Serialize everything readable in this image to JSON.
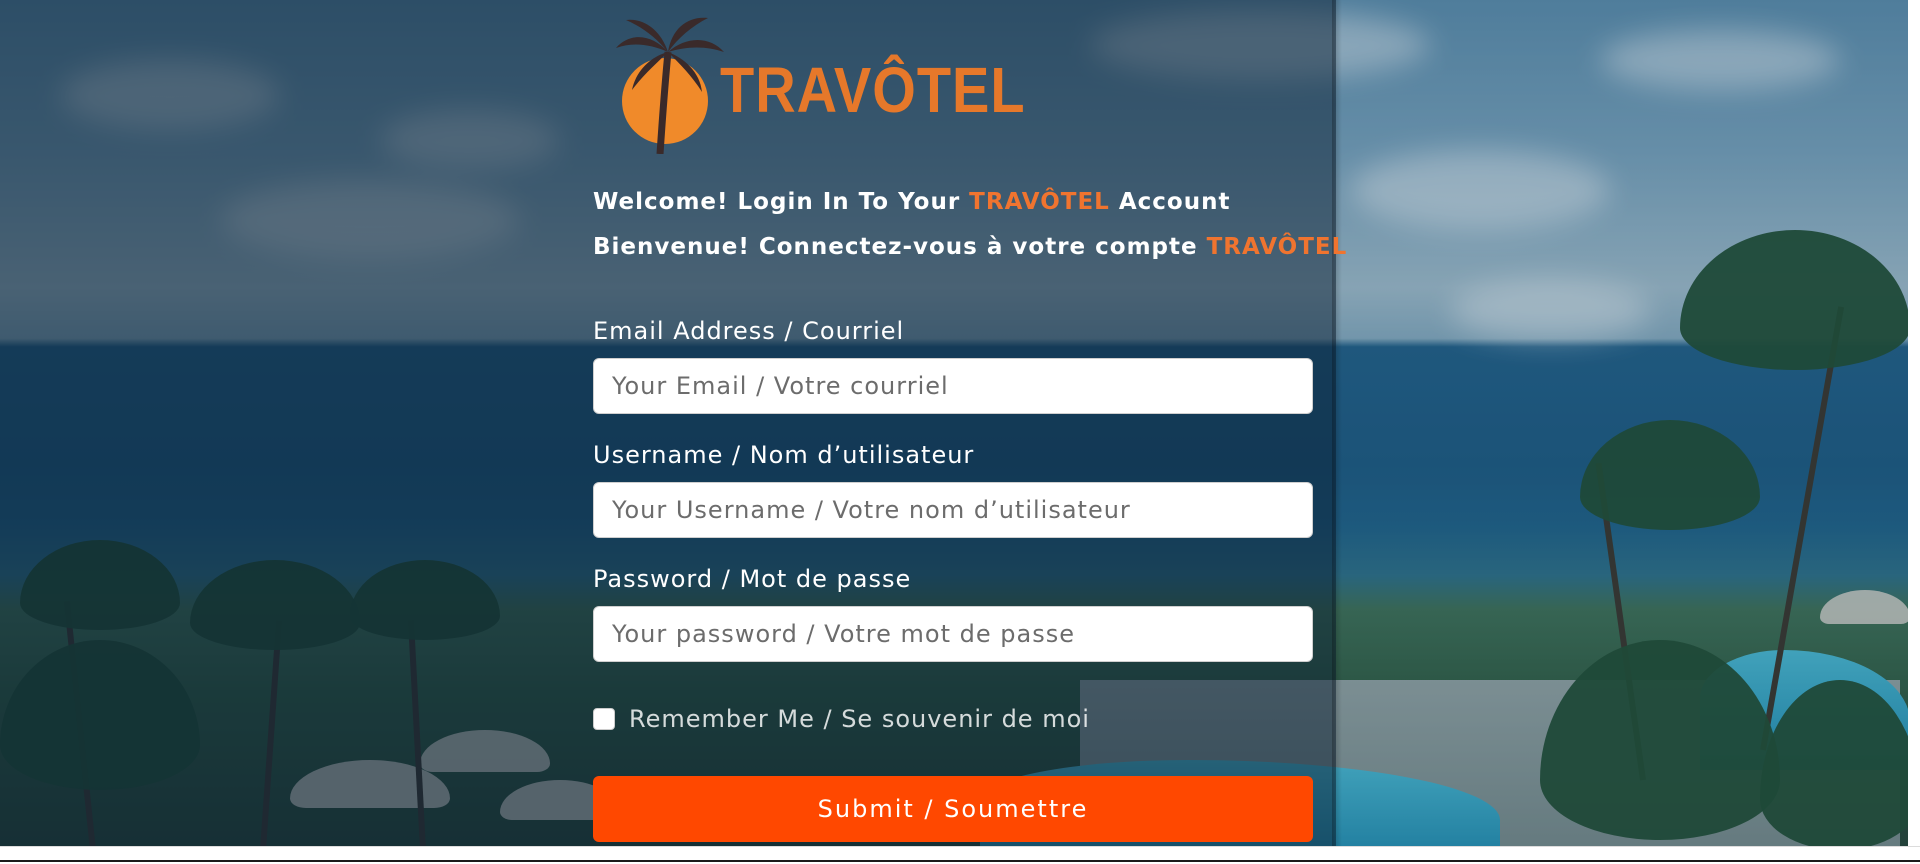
{
  "logo": {
    "text": "TRAVÔTEL",
    "brand_color": "#e6782a",
    "icon": "palm-sun-icon"
  },
  "welcome": {
    "line1_prefix": "Welcome! Login In To Your ",
    "line1_brand": "TRAVÔTEL",
    "line1_suffix": " Account",
    "line2_prefix": "Bienvenue! Connectez-vous à votre compte ",
    "line2_brand": "TRAVÔTEL"
  },
  "form": {
    "email": {
      "label": "Email Address / Courriel",
      "placeholder": "Your Email / Votre courriel",
      "value": ""
    },
    "username": {
      "label": "Username / Nom d’utilisateur",
      "placeholder": "Your Username / Votre nom d’utilisateur",
      "value": ""
    },
    "password": {
      "label": "Password / Mot de passe",
      "placeholder": "Your password / Votre mot de passe",
      "value": ""
    },
    "remember": {
      "label": "Remember Me / Se souvenir de moi",
      "checked": false
    },
    "submit_label": "Submit / Soumettre"
  },
  "colors": {
    "accent": "#f0742f",
    "submit": "#ff4800",
    "overlay": "#0e263c"
  }
}
